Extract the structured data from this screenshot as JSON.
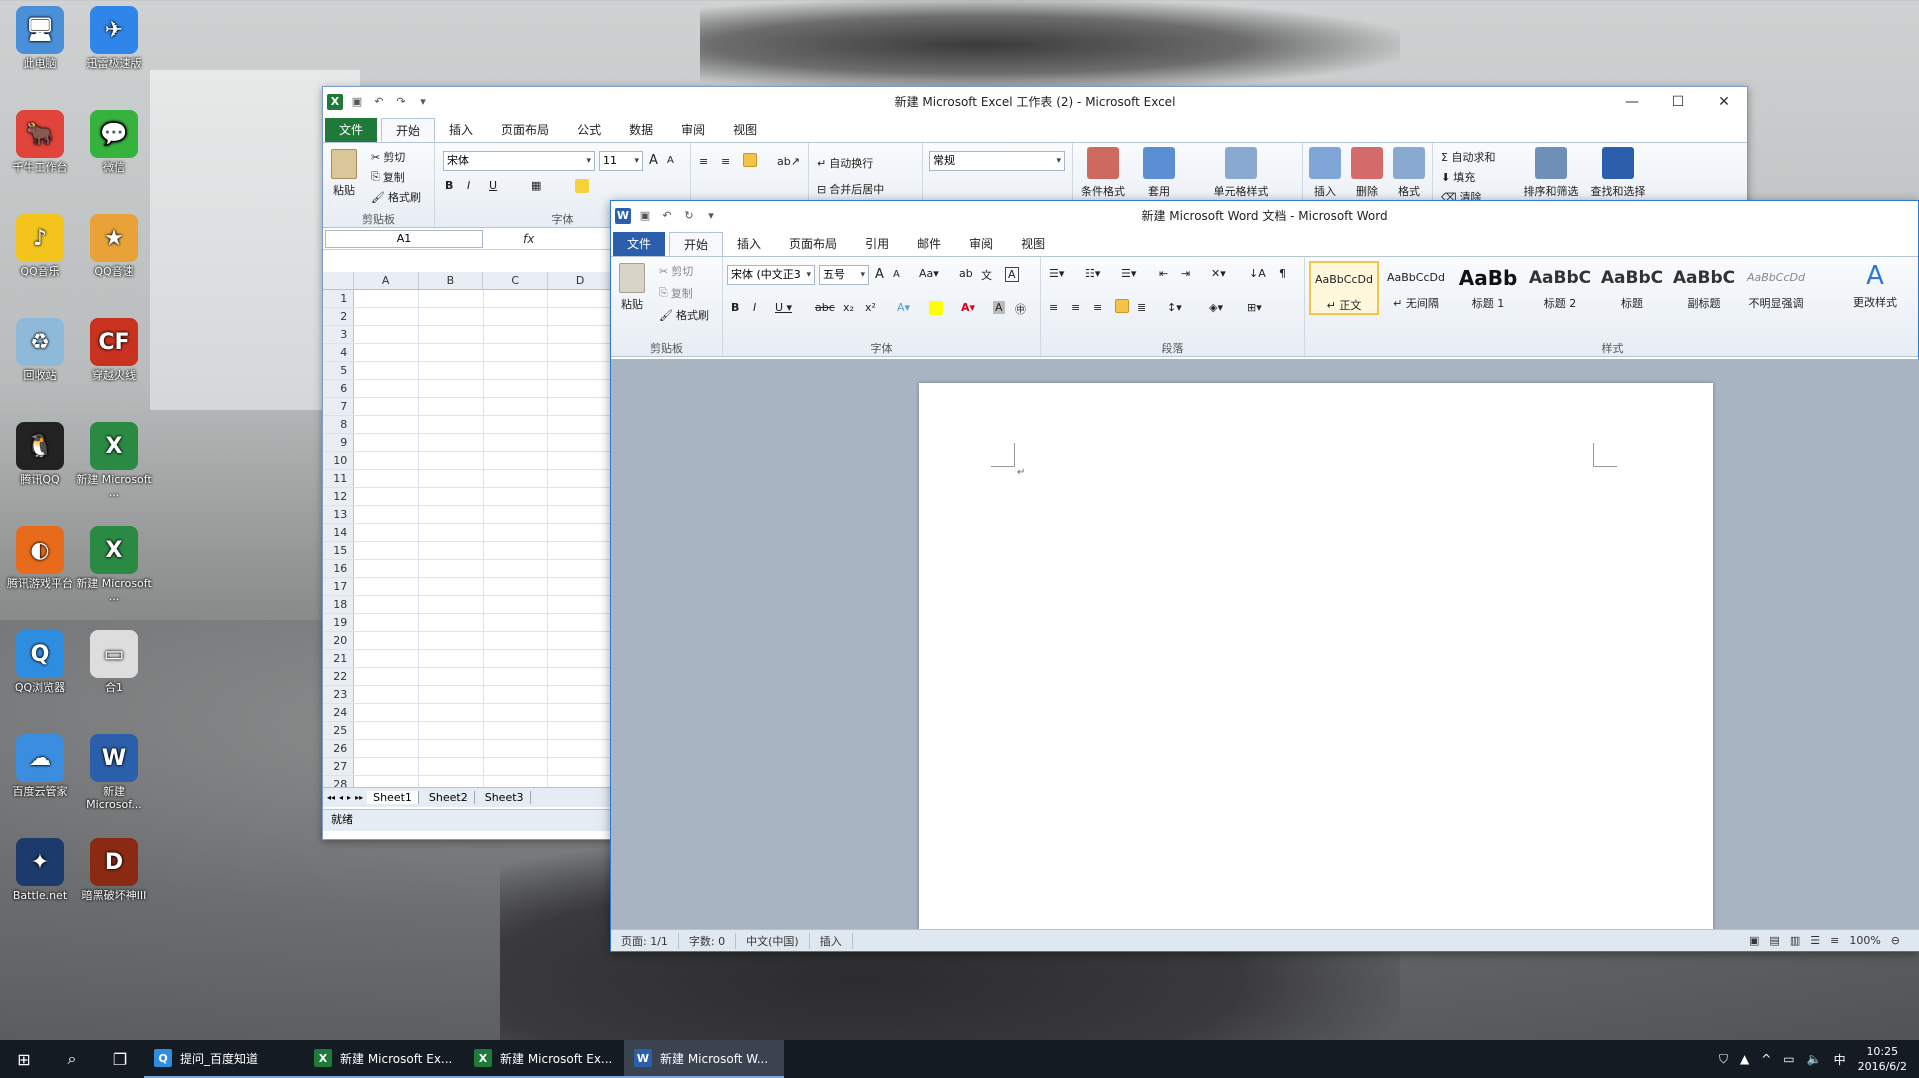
{
  "desktop": {
    "icons": [
      {
        "label": "此电脑",
        "icon": "computer-icon",
        "color": "#4a90d9"
      },
      {
        "label": "迅雷极速版",
        "icon": "thunder-icon",
        "color": "#2f86e8"
      },
      {
        "label": "千牛工作台",
        "icon": "qianniu-icon",
        "color": "#e0443a"
      },
      {
        "label": "微信",
        "icon": "wechat-icon",
        "color": "#36b33d"
      },
      {
        "label": "QQ音乐",
        "icon": "qqmusic-icon",
        "color": "#f3c41b"
      },
      {
        "label": "QQ音速",
        "icon": "qqspeed-icon",
        "color": "#e8a237"
      },
      {
        "label": "回收站",
        "icon": "recycle-bin-icon",
        "color": "#8fb9d9"
      },
      {
        "label": "穿越火线",
        "icon": "crossfire-icon",
        "color": "#c8321f"
      },
      {
        "label": "腾讯QQ",
        "icon": "qq-icon",
        "color": "#222222"
      },
      {
        "label": "新建 Microsoft ...",
        "icon": "excel-file-icon",
        "color": "#2a8a43"
      },
      {
        "label": "腾讯游戏平台",
        "icon": "tgp-icon",
        "color": "#e86b1c"
      },
      {
        "label": "新建 Microsoft ...",
        "icon": "excel-file-icon",
        "color": "#2a8a43"
      },
      {
        "label": "QQ浏览器",
        "icon": "qqbrowser-icon",
        "color": "#2f8de0"
      },
      {
        "label": "合1",
        "icon": "image-file-icon",
        "color": "#dddddd"
      },
      {
        "label": "百度云管家",
        "icon": "baiduyun-icon",
        "color": "#3b8de0"
      },
      {
        "label": "新建 Microsof...",
        "icon": "word-file-icon",
        "color": "#2b5fab"
      },
      {
        "label": "Battle.net",
        "icon": "battlenet-icon",
        "color": "#1c3a6b"
      },
      {
        "label": "暗黑破坏神III",
        "icon": "diablo-icon",
        "color": "#8a2a12"
      }
    ]
  },
  "excel": {
    "title": "新建 Microsoft Excel 工作表 (2) - Microsoft Excel",
    "tabs": [
      "文件",
      "开始",
      "插入",
      "页面布局",
      "公式",
      "数据",
      "审阅",
      "视图"
    ],
    "clipboard": {
      "paste": "粘贴",
      "cut": "剪切",
      "copy": "复制",
      "format_painter": "格式刷",
      "group": "剪贴板"
    },
    "font": {
      "name": "宋体",
      "size": "11",
      "group": "字体"
    },
    "alignment": {
      "wrap": "自动换行",
      "merge": "合并后居中"
    },
    "number": {
      "format": "常规"
    },
    "styles": {
      "conditional": "条件格式",
      "table": "套用",
      "cell": "单元格样式"
    },
    "cells": {
      "insert": "插入",
      "delete": "删除",
      "format": "格式"
    },
    "editing": {
      "autosum": "Σ 自动求和",
      "fill": "填充",
      "clear": "清除",
      "sort": "排序和筛选",
      "find": "查找和选择"
    },
    "namebox": "A1",
    "fx": "fx",
    "columns": [
      "A",
      "B",
      "C",
      "D"
    ],
    "rows": [
      "1",
      "2",
      "3",
      "4",
      "5",
      "6",
      "7",
      "8",
      "9",
      "10",
      "11",
      "12",
      "13",
      "14",
      "15",
      "16",
      "17",
      "18",
      "19",
      "20",
      "21",
      "22",
      "23",
      "24",
      "25",
      "26",
      "27",
      "28"
    ],
    "sheets": [
      "Sheet1",
      "Sheet2",
      "Sheet3"
    ],
    "status": "就绪"
  },
  "word": {
    "title": "新建 Microsoft Word 文档 - Microsoft Word",
    "tabs": [
      "文件",
      "开始",
      "插入",
      "页面布局",
      "引用",
      "邮件",
      "审阅",
      "视图"
    ],
    "clipboard": {
      "paste": "粘贴",
      "cut": "剪切",
      "copy": "复制",
      "format_painter": "格式刷",
      "group": "剪贴板"
    },
    "font": {
      "name": "宋体 (中文正3",
      "size": "五号",
      "group": "字体"
    },
    "paragraph_group": "段落",
    "styles_group": "样式",
    "change_styles": "更改样式",
    "styles": [
      {
        "preview": "AaBbCcDd",
        "name": "↵ 正文"
      },
      {
        "preview": "AaBbCcDd",
        "name": "↵ 无间隔"
      },
      {
        "preview": "AaBb",
        "name": "标题 1"
      },
      {
        "preview": "AaBbC",
        "name": "标题 2"
      },
      {
        "preview": "AaBbC",
        "name": "标题"
      },
      {
        "preview": "AaBbC",
        "name": "副标题"
      },
      {
        "preview": "AaBbCcDd",
        "name": "不明显强调"
      }
    ],
    "status": {
      "page": "页面: 1/1",
      "words": "字数: 0",
      "lang": "中文(中国)",
      "mode": "插入",
      "zoom": "100%"
    }
  },
  "taskbar": {
    "apps": [
      {
        "label": "提问_百度知道",
        "icon": "browser-icon"
      },
      {
        "label": "新建 Microsoft Ex...",
        "icon": "excel-icon"
      },
      {
        "label": "新建 Microsoft Ex...",
        "icon": "excel-icon"
      },
      {
        "label": "新建 Microsoft W...",
        "icon": "word-icon"
      }
    ],
    "ime": "中",
    "time": "10:25",
    "date": "2016/6/2"
  }
}
